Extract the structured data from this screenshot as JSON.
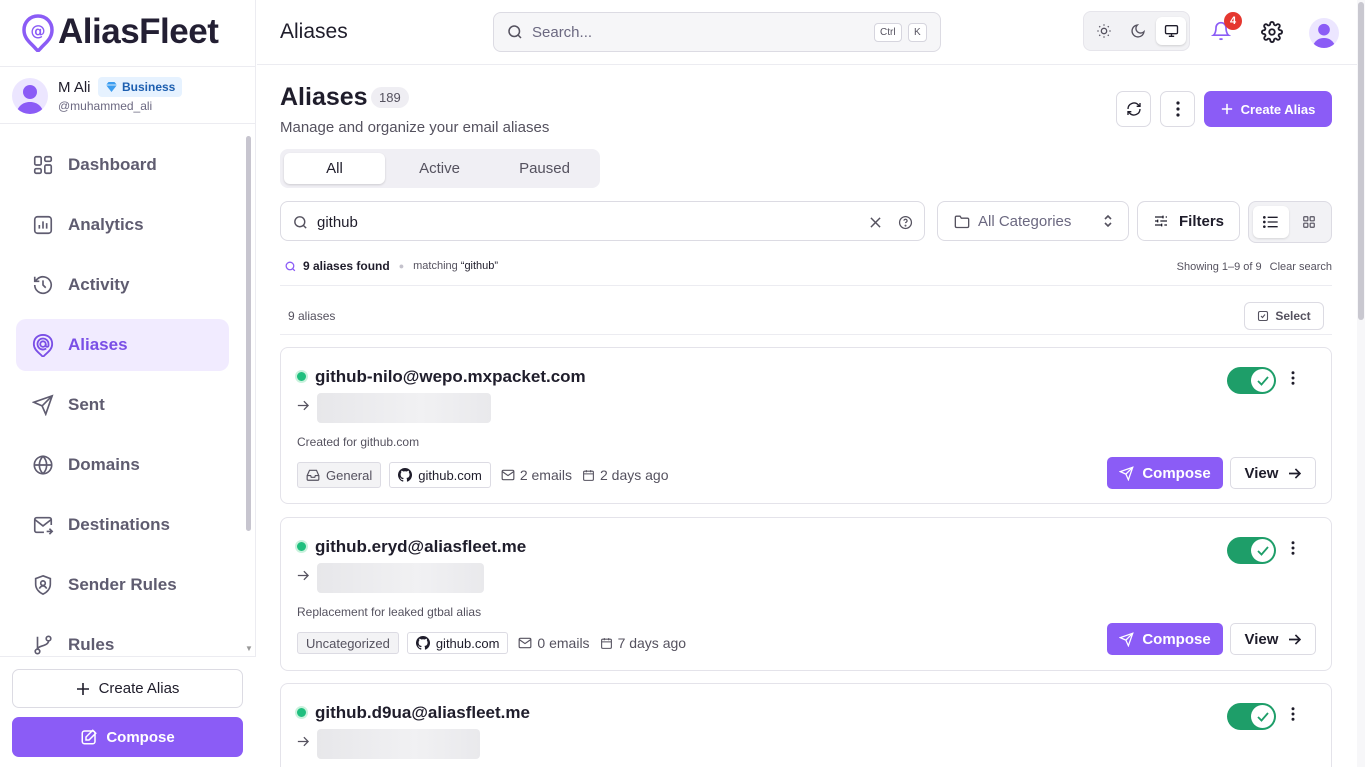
{
  "app": {
    "name": "AliasFleet"
  },
  "user": {
    "name": "M Ali",
    "plan": "Business",
    "handle": "@muhammed_ali"
  },
  "nav": {
    "items": [
      {
        "label": "Dashboard",
        "icon": "dashboard-icon"
      },
      {
        "label": "Analytics",
        "icon": "analytics-icon"
      },
      {
        "label": "Activity",
        "icon": "history-icon"
      },
      {
        "label": "Aliases",
        "icon": "alias-icon",
        "active": true
      },
      {
        "label": "Sent",
        "icon": "send-icon"
      },
      {
        "label": "Domains",
        "icon": "globe-icon"
      },
      {
        "label": "Destinations",
        "icon": "mail-forward-icon"
      },
      {
        "label": "Sender Rules",
        "icon": "shield-user-icon"
      },
      {
        "label": "Rules",
        "icon": "branch-icon"
      }
    ]
  },
  "sidebar_actions": {
    "create_alias": "Create Alias",
    "compose": "Compose"
  },
  "topbar": {
    "title": "Aliases",
    "search_placeholder": "Search...",
    "shortcut": [
      "Ctrl",
      "K"
    ],
    "theme_options": [
      "light",
      "dark",
      "system"
    ],
    "theme_selected": "system",
    "notification_count": "4"
  },
  "page": {
    "title": "Aliases",
    "count": "189",
    "subtitle": "Manage and organize your email aliases",
    "create_label": "Create Alias",
    "tabs": [
      "All",
      "Active",
      "Paused"
    ],
    "active_tab": "All"
  },
  "filters": {
    "search_value": "github",
    "category": "All Categories",
    "filters_label": "Filters",
    "view_mode": "list"
  },
  "results": {
    "found": "9 aliases found",
    "matching_prefix": "matching",
    "matching_term": "“github”",
    "showing": "Showing 1–9 of 9",
    "clear": "Clear search",
    "count_label": "9 aliases",
    "select_label": "Select"
  },
  "aliases": [
    {
      "email": "github-nilo@wepo.mxpacket.com",
      "note": "Created for github.com",
      "category": "General",
      "service": "github.com",
      "emails": "2 emails",
      "age": "2 days ago",
      "active": true,
      "compose": "Compose",
      "view": "View"
    },
    {
      "email": "github.eryd@aliasfleet.me",
      "note": "Replacement for leaked gtbal alias",
      "category": "Uncategorized",
      "service": "github.com",
      "emails": "0 emails",
      "age": "7 days ago",
      "active": true,
      "compose": "Compose",
      "view": "View"
    },
    {
      "email": "github.d9ua@aliasfleet.me",
      "active": true
    }
  ],
  "colors": {
    "accent": "#8b5cf6",
    "active_bg": "#f1ebff",
    "toggle_on": "#1e9e69",
    "status_dot": "#1fbf7e",
    "badge": "#e5372f"
  }
}
